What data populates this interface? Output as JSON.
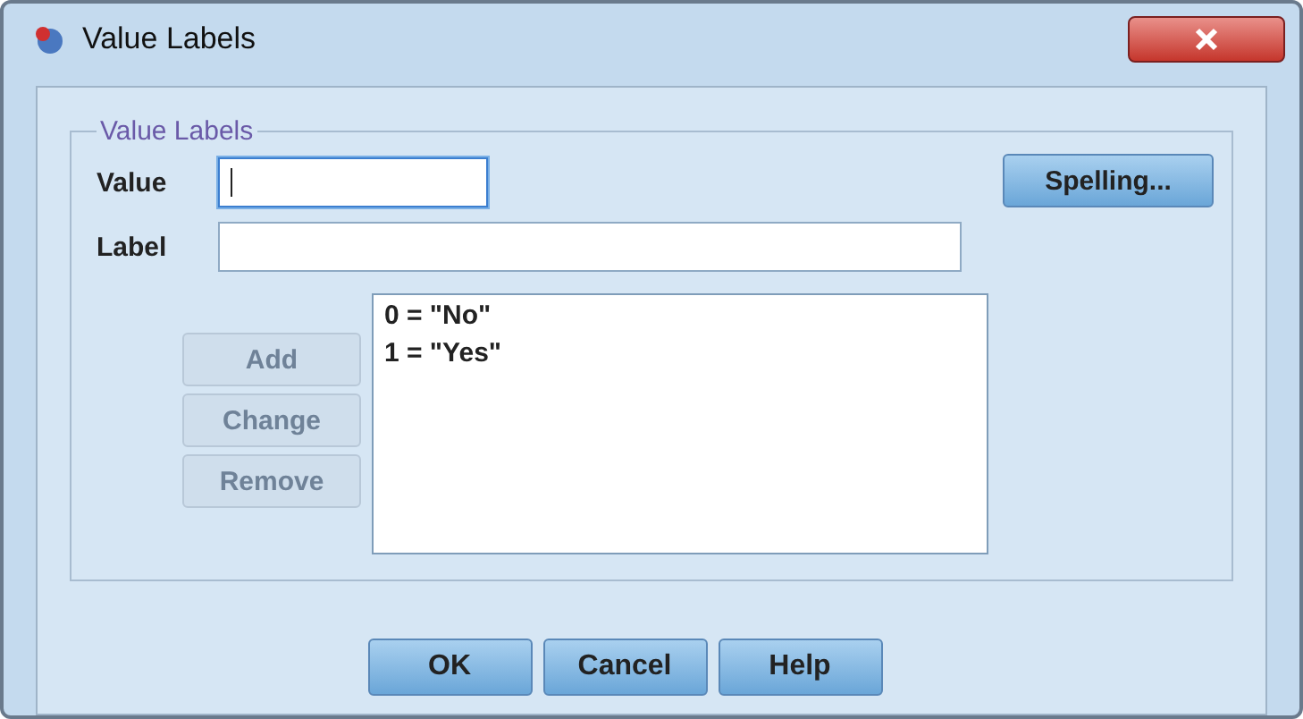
{
  "window": {
    "title": "Value Labels"
  },
  "group": {
    "title": "Value Labels"
  },
  "fields": [
    {
      "label": "Value",
      "focused": true
    },
    {
      "label": "Label",
      "focused": false
    }
  ],
  "spelling_button": {
    "label": "Spelling..."
  },
  "side_buttons": [
    {
      "label": "Add",
      "disabled": true
    },
    {
      "label": "Change",
      "disabled": true
    },
    {
      "label": "Remove",
      "disabled": true
    }
  ],
  "labels_list": [
    "0 = \"No\"",
    "1 = \"Yes\""
  ],
  "footer_buttons": [
    "OK",
    "Cancel",
    "Help"
  ]
}
